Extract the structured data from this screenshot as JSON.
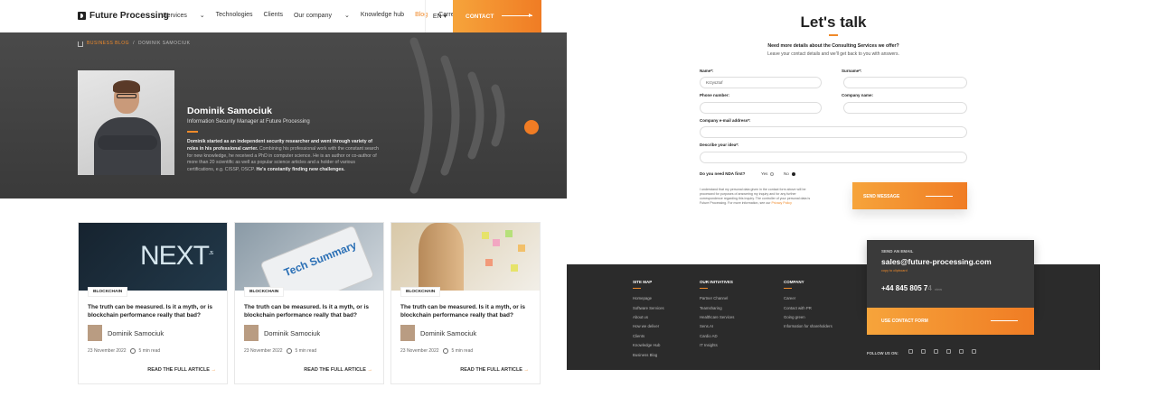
{
  "nav": {
    "logo": "Future Processing",
    "items": [
      "Services",
      "Technologies",
      "Clients",
      "Our company",
      "Knowledge hub",
      "Blog",
      "Carrer"
    ],
    "lang": "EN",
    "contact": "CONTACT"
  },
  "hero": {
    "breadcrumb": [
      "BUSINESS BLOG",
      "DOMINIK SAMOCIUK"
    ],
    "name": "Dominik Samociuk",
    "title": "Information Security Manager at Future Processing",
    "bio_bold1": "Dominik started as an independent security researcher and went through variety of roles in his professional carrier.",
    "bio_text": " Combining his professional work with the constant search for new knowledge, he received a PhD in computer science. He is an author or co-author of more than 20 scientific as well as popular science articles and a holder of various certifications, e.g. CISSP, OSCP.",
    "bio_bold2": " He's constantly finding new challenges."
  },
  "cards": [
    {
      "tag": "BLOCKCHAIN",
      "title": "The truth can be measured. Is it a myth, or is blockchain performance really that bad?",
      "author": "Dominik Samociuk",
      "date": "23 November 2022",
      "read": "5 min read",
      "cta": "READ THE FULL ARTICLE",
      "image_text": "NEXT",
      "image_sub": ".JS"
    },
    {
      "tag": "BLOCKCHAIN",
      "title": "The truth can be measured. Is it a myth, or is blockchain performance really that bad?",
      "author": "Dominik Samociuk",
      "date": "23 November 2022",
      "read": "5 min read",
      "cta": "READ THE FULL ARTICLE",
      "image_text": "Tech Summary"
    },
    {
      "tag": "BLOCKCHAIN",
      "title": "The truth can be measured. Is it a myth, or is blockchain performance really that bad?",
      "author": "Dominik Samociuk",
      "date": "23 November 2022",
      "read": "5 min read",
      "cta": "READ THE FULL ARTICLE"
    }
  ],
  "talk": {
    "title": "Let's talk",
    "sub1": "Need more details about the Consulting Services we offer?",
    "sub2": "Leave your contact details and we'll get back to you with answers.",
    "name_label": "Name*:",
    "name_value": "Krzysztof",
    "surname_label": "Surname*:",
    "phone_label": "Phone number:",
    "company_label": "Company name:",
    "email_label": "Company e-mail address*:",
    "idea_label": "Describe your idea*:",
    "nda_label": "Do you need NDA first?",
    "yes": "Yes",
    "no": "No",
    "legal": "I understand that my personal data given in the contact form above will be processed for purposes of answering my inquiry and for any further correspondence regarding this inquiry. The controller of your personal data is Future Processing. For more information, see our ",
    "legal_link": "Privacy Policy",
    "send": "SEND MESSAGE"
  },
  "footer": {
    "cols": [
      {
        "head": "SITE MAP",
        "links": [
          "Homepage",
          "Software Services",
          "About us",
          "How we deliver",
          "Clients",
          "Knowledge Hub",
          "Business Blog"
        ]
      },
      {
        "head": "OUR INITIATIVES",
        "links": [
          "Partner Channel",
          "Teamsharing",
          "Healthcare Services",
          "Sens.AI",
          "Cardio AD",
          "IT Insights"
        ]
      },
      {
        "head": "COMPANY",
        "links": [
          "Career",
          "Contact with PR",
          "Going green",
          "Information for shareholders"
        ]
      }
    ],
    "email_label": "SEND AN EMAIL",
    "email": "sales@future-processing.com",
    "copy": "copy to clipboard",
    "phone": "+44 845 805 7",
    "phone_hidden": "4",
    "view": "view",
    "contact_form": "USE CONTACT FORM",
    "follow": "FOLLOW US ON:"
  },
  "colors": {
    "accent": "#f07c24",
    "dark": "#2b2b2b"
  }
}
